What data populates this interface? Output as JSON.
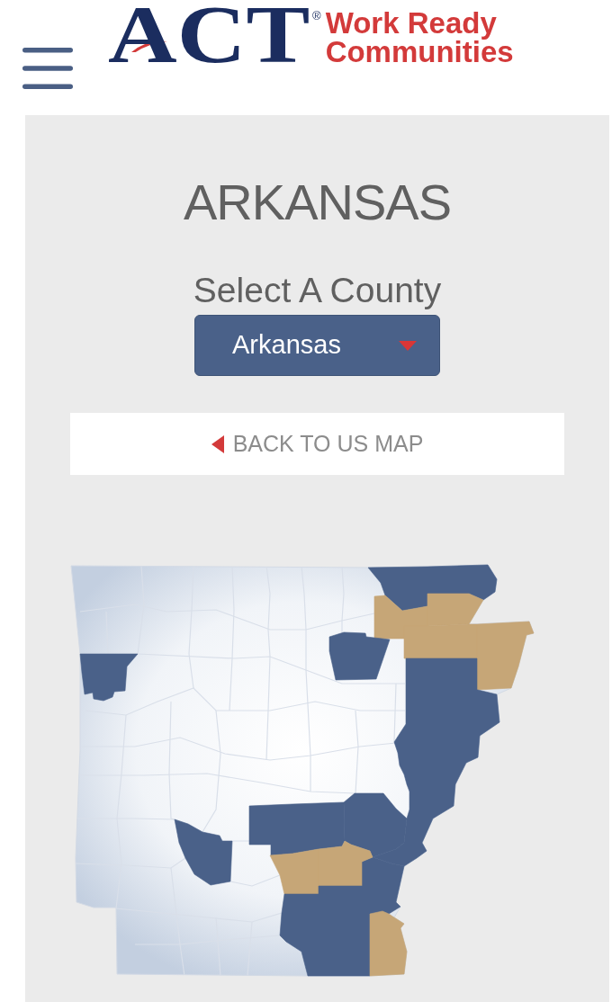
{
  "header": {
    "logo": {
      "wordmark": "ACT",
      "registered_mark": "®",
      "tagline": "Work Ready Communities"
    }
  },
  "state_panel": {
    "title": "ARKANSAS",
    "county_label": "Select A County",
    "county_select": {
      "value": "Arkansas"
    },
    "back_button": {
      "label": "BACK TO US MAP"
    },
    "map": {
      "counties": [
        {
          "color": "#4a6189"
        },
        {
          "color": "#4a6189"
        },
        {
          "color": "#c6a677"
        },
        {
          "color": "#c6a677"
        },
        {
          "color": "#c6a677"
        },
        {
          "color": "#c6a677"
        },
        {
          "color": "#4a6189"
        },
        {
          "color": "#4a6189"
        },
        {
          "color": "#4a6189"
        },
        {
          "color": "#4a6189"
        },
        {
          "color": "#4a6189"
        },
        {
          "color": "#4a6189"
        },
        {
          "color": "#4a6189"
        },
        {
          "color": "#4a6189"
        },
        {
          "color": "#4a6189"
        },
        {
          "color": "#4a6189"
        },
        {
          "color": "#4a6189"
        },
        {
          "color": "#4a6189"
        },
        {
          "color": "#4a6189"
        },
        {
          "color": "#c6a677"
        },
        {
          "color": "#c6a677"
        },
        {
          "color": "#4a6189"
        },
        {
          "color": "#4a6189"
        },
        {
          "color": "#4a6189"
        },
        {
          "color": "#c6a677"
        },
        {
          "color": "#4a6189"
        }
      ]
    }
  }
}
